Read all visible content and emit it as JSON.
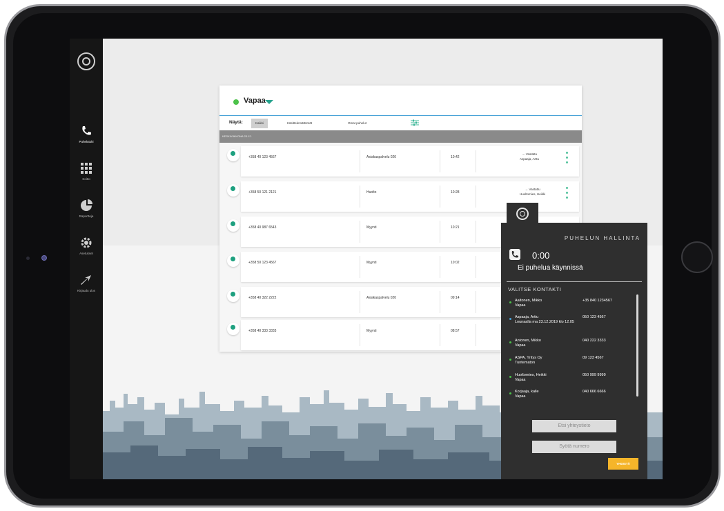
{
  "sidebar": {
    "items": [
      {
        "label": "Puhelutoki",
        "icon": "phone-icon"
      },
      {
        "label": "Soitto",
        "icon": "dialpad-icon"
      },
      {
        "label": "Raportteja",
        "icon": "chart-icon"
      },
      {
        "label": "Asetukset",
        "icon": "settings-icon"
      },
      {
        "label": "Kirjaudu ulos",
        "icon": "logout-icon"
      }
    ]
  },
  "status": {
    "label": "Vapaa",
    "color": "#4cc24a"
  },
  "filter": {
    "label": "Näytä:",
    "tabs": [
      "Kaikki",
      "Käsittelemättömät",
      "Omat puhelut"
    ]
  },
  "date_bar": "KESKIVIIKKONA 23.12.",
  "calls": [
    {
      "number": "+358 40 123 4567",
      "queue": "Asiakaspalvelu 020",
      "time": "10:42",
      "status_line": "→ Vastattu",
      "agent": "Aspaaja, Arttu"
    },
    {
      "number": "+358 50 121 2121",
      "queue": "Huolto",
      "time": "10:28",
      "status_line": "→ Vastattu",
      "agent": "Huoltomies, Heikki"
    },
    {
      "number": "+358 40 987 6543",
      "queue": "Myynti",
      "time": "10:21",
      "status_line": "",
      "agent": ""
    },
    {
      "number": "+358 50 123 4567",
      "queue": "Myynti",
      "time": "10:02",
      "status_line": "",
      "agent": ""
    },
    {
      "number": "+358 40 322 2222",
      "queue": "Asiakaspalvelu 020",
      "time": "09:14",
      "status_line": "",
      "agent": ""
    },
    {
      "number": "+358 40 333 3333",
      "queue": "Myynti",
      "time": "08:57",
      "status_line": "",
      "agent": ""
    }
  ],
  "hallinta": {
    "title": "PUHELUN HALLINTA",
    "timer": "0:00",
    "status": "Ei puhelua käynnissä",
    "section": "VALITSE KONTAKTI",
    "contacts": [
      {
        "name": "Aaltonen, Mikko",
        "sub": "Vapaa",
        "number": "+35 840 1234567"
      },
      {
        "name": "Aspaaja, Arttu",
        "sub": "Lounaalla ma 23.12.2019 klo 12.05",
        "number": "050 123 4567"
      },
      {
        "name": "Antonen, Mikko",
        "sub": "Vapaa",
        "number": "040 222 3333"
      },
      {
        "name": "ASPA, Yritys Oy",
        "sub": "Tuntematon",
        "number": "09 123 4567"
      },
      {
        "name": "Huoltomies, Heikki",
        "sub": "Vapaa",
        "number": "050 999 9999"
      },
      {
        "name": "Korjaaja, kalle",
        "sub": "Vapaa",
        "number": "040 666 6666"
      }
    ],
    "search_button": "Etsi yhteystieto",
    "enter_button": "Syötä numero",
    "action_button": "YHDISTÄ"
  }
}
